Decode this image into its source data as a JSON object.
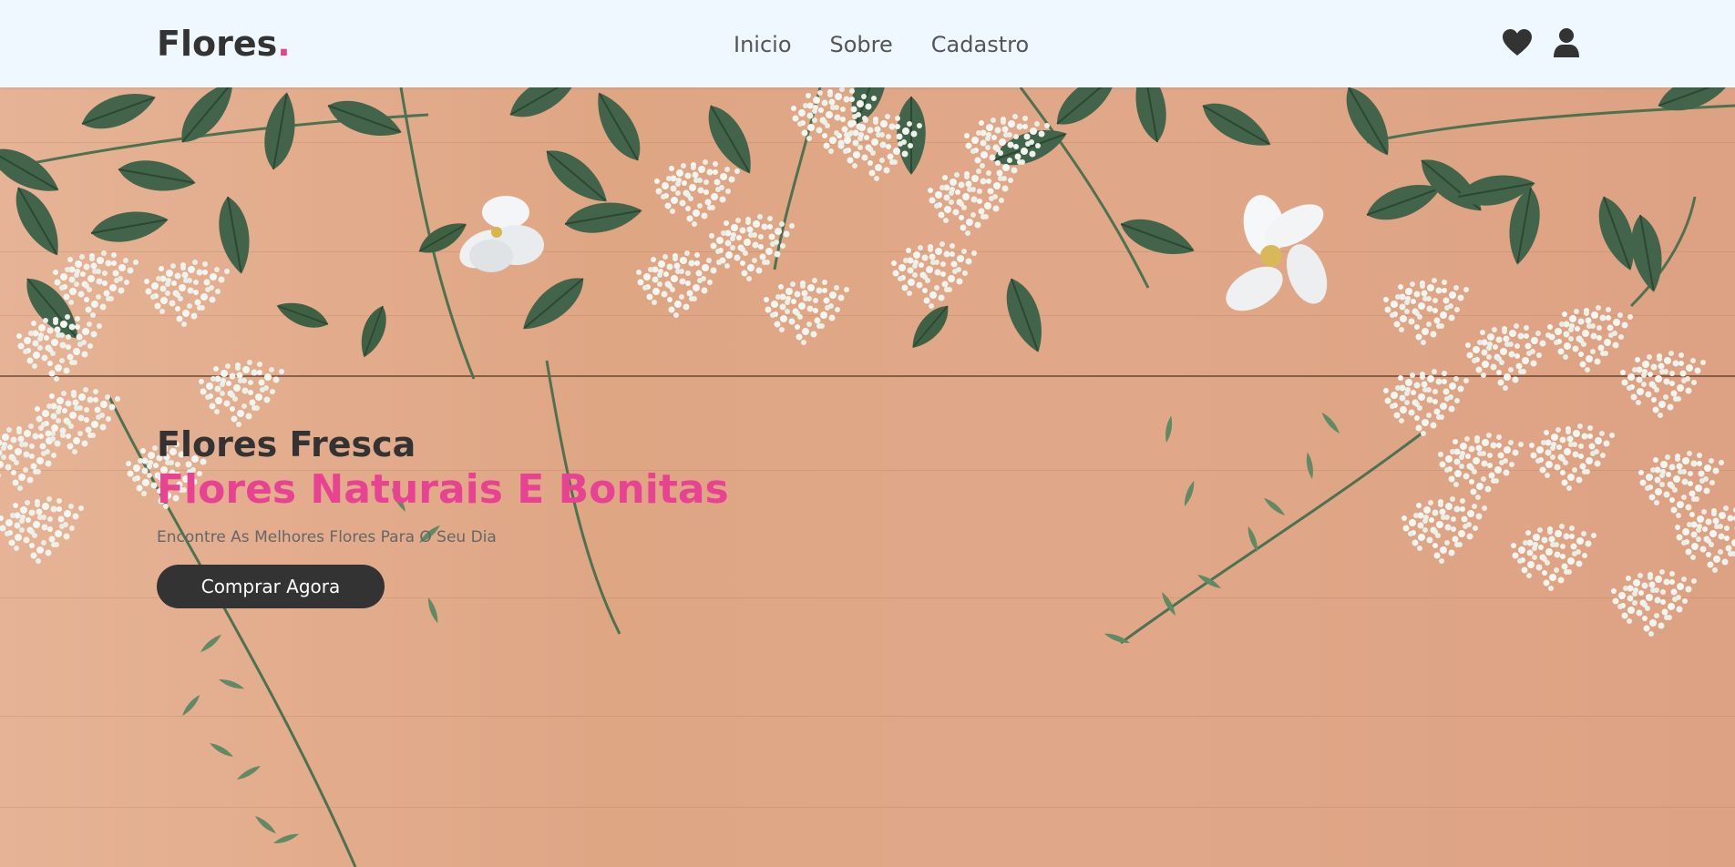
{
  "header": {
    "logo_text": "Flores",
    "logo_dot": ".",
    "nav": [
      {
        "label": "Inicio"
      },
      {
        "label": "Sobre"
      },
      {
        "label": "Cadastro"
      }
    ],
    "icons": [
      "heart-icon",
      "user-icon"
    ]
  },
  "hero": {
    "title": "Flores Fresca",
    "subtitle": "Flores Naturais E Bonitas",
    "text": "Encontre As Melhores Flores Para O Seu Dia",
    "button_label": "Comprar Agora"
  },
  "colors": {
    "accent": "#e84393",
    "dark": "#333333",
    "header_bg": "#eff8ff",
    "wood": "#dfa684",
    "leaf": "#3e5f40"
  }
}
